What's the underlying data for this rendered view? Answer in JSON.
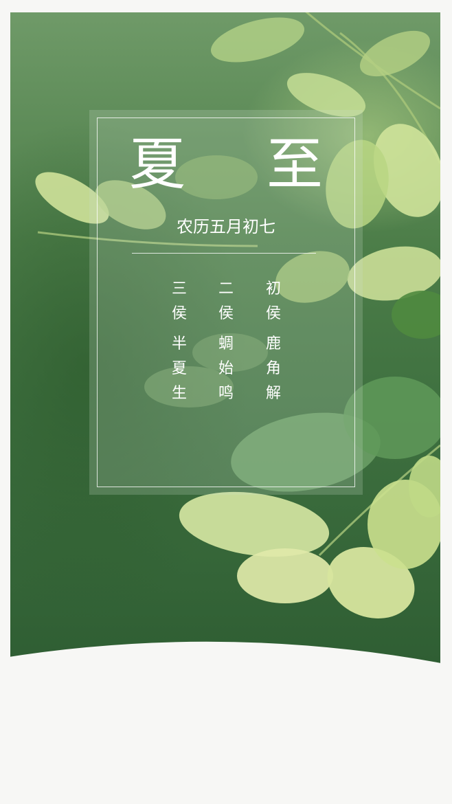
{
  "poster": {
    "title": "夏 至",
    "lunar_date": "农历五月初七",
    "pentads": [
      {
        "head": [
          "三",
          "侯"
        ],
        "body": [
          "半",
          "夏",
          "生"
        ]
      },
      {
        "head": [
          "二",
          "侯"
        ],
        "body": [
          "蜩",
          "始",
          "鸣"
        ]
      },
      {
        "head": [
          "初",
          "侯"
        ],
        "body": [
          "鹿",
          "角",
          "解"
        ]
      }
    ]
  },
  "colors": {
    "foliage_dark": "#3f7140",
    "leaf_light": "#c9df8e",
    "text": "#ffffff",
    "page_bg": "#f7f7f5"
  }
}
